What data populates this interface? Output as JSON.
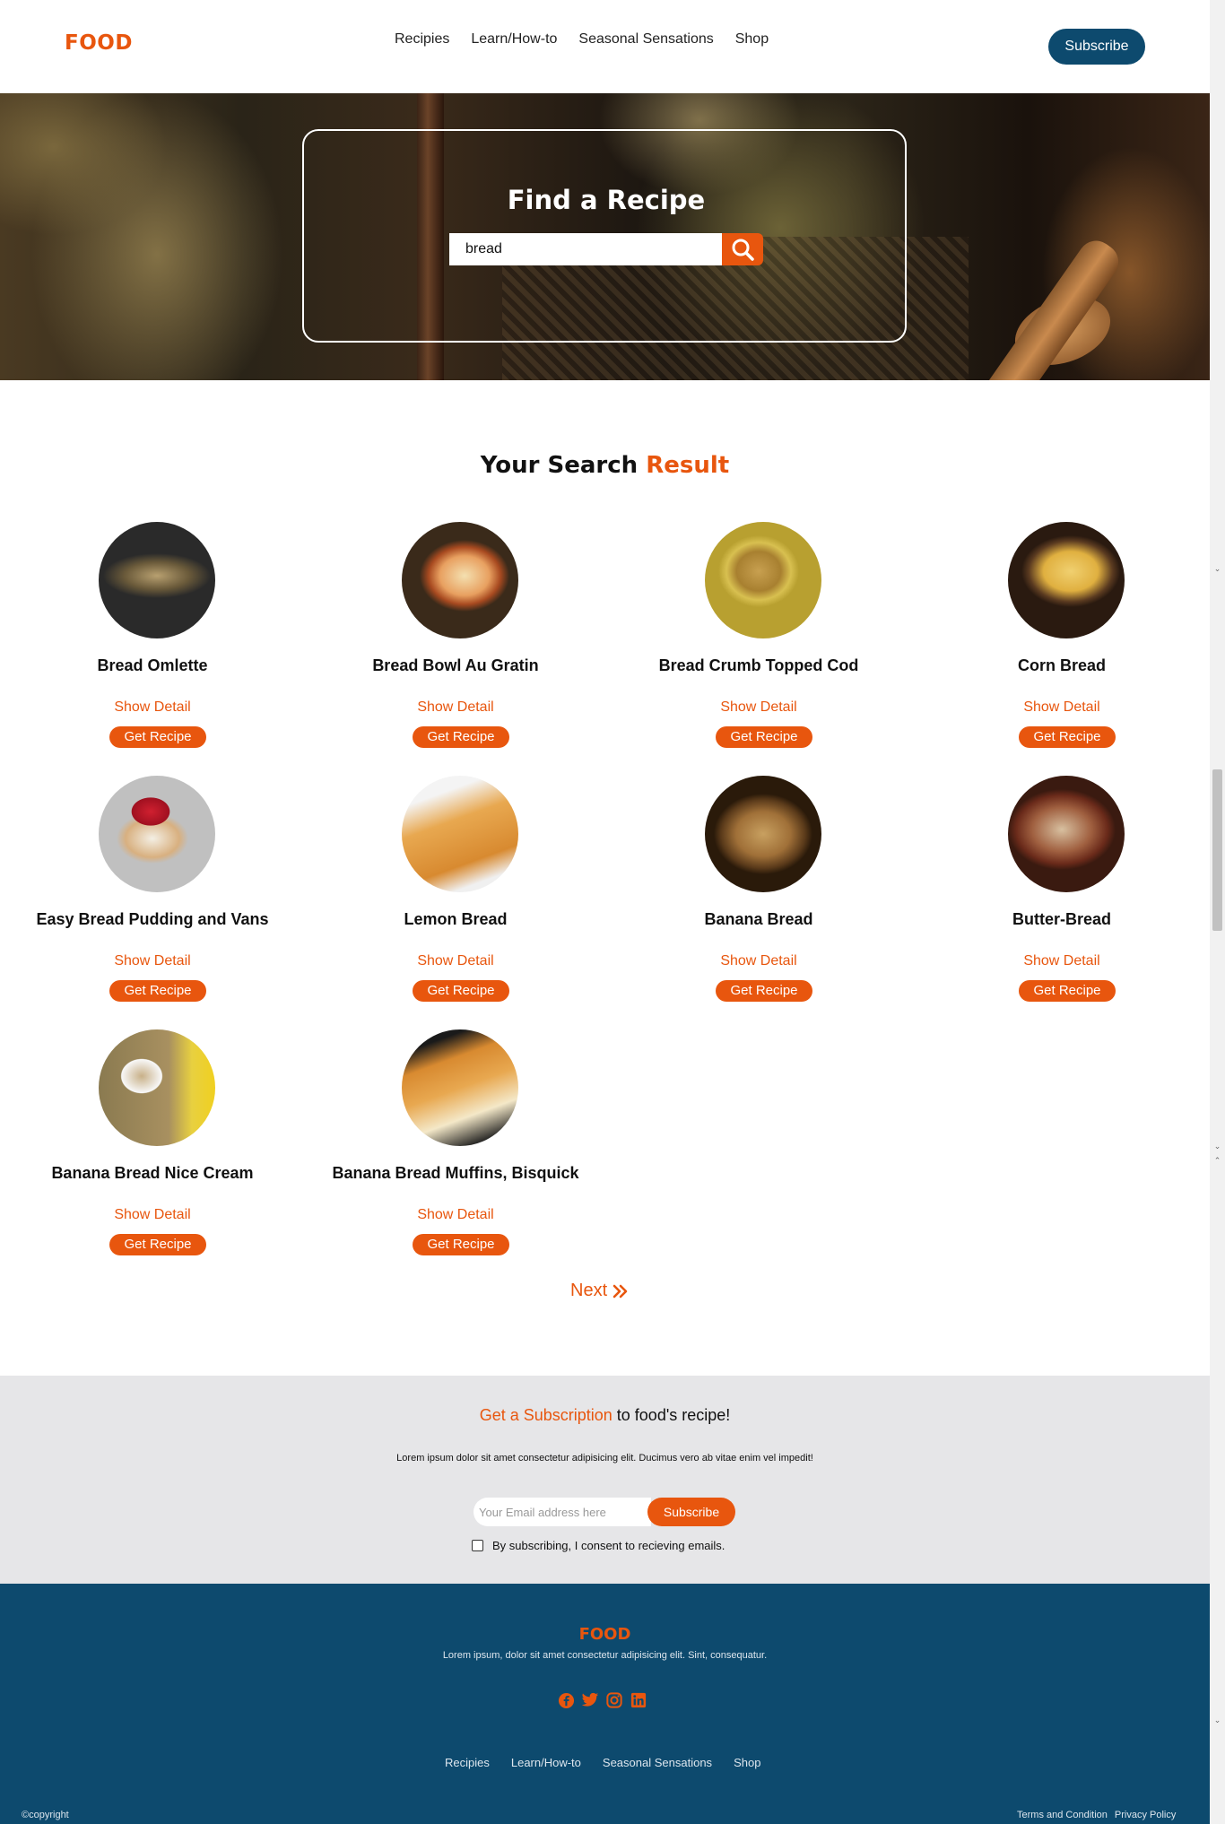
{
  "header": {
    "logo": "FOOD",
    "nav": [
      "Recipies",
      "Learn/How-to",
      "Seasonal Sensations",
      "Shop"
    ],
    "subscribe_label": "Subscribe"
  },
  "hero": {
    "title": "Find a Recipe",
    "search_value": "bread",
    "search_icon": "search-icon"
  },
  "results": {
    "title_plain": "Your Search",
    "title_accent": "Result",
    "show_detail_label": "Show Detail",
    "get_recipe_label": "Get Recipe",
    "items": [
      {
        "title": "Bread Omlette"
      },
      {
        "title": "Bread Bowl Au Gratin"
      },
      {
        "title": "Bread Crumb Topped Cod"
      },
      {
        "title": "Corn Bread"
      },
      {
        "title": "Easy Bread Pudding and Vans"
      },
      {
        "title": "Lemon Bread"
      },
      {
        "title": "Banana Bread"
      },
      {
        "title": "Butter-Bread"
      },
      {
        "title": "Banana Bread Nice Cream"
      },
      {
        "title": "Banana Bread Muffins, Bisquick"
      }
    ],
    "next_label": "Next"
  },
  "subscription": {
    "heading_accent": "Get a Subscription",
    "heading_rest": "to food's recipe!",
    "text": "Lorem ipsum dolor sit amet consectetur adipisicing elit. Ducimus vero ab vitae enim vel impedit!",
    "email_placeholder": "Your Email address here",
    "button_label": "Subscribe",
    "consent_label": "By subscribing, I consent to recieving emails."
  },
  "footer": {
    "logo": "FOOD",
    "text": "Lorem ipsum, dolor sit amet consectetur adipisicing elit. Sint, consequatur.",
    "social_icons": [
      "facebook-icon",
      "twitter-icon",
      "instagram-icon",
      "linkedin-icon"
    ],
    "nav": [
      "Recipies",
      "Learn/How-to",
      "Seasonal Sensations",
      "Shop"
    ],
    "copyright": "©copyright",
    "links": [
      "Terms and Condition",
      "Privacy Policy"
    ]
  },
  "colors": {
    "accent": "#e8560e",
    "brand_dark": "#0d4a6e",
    "subscription_bg": "#e6e6e8"
  }
}
